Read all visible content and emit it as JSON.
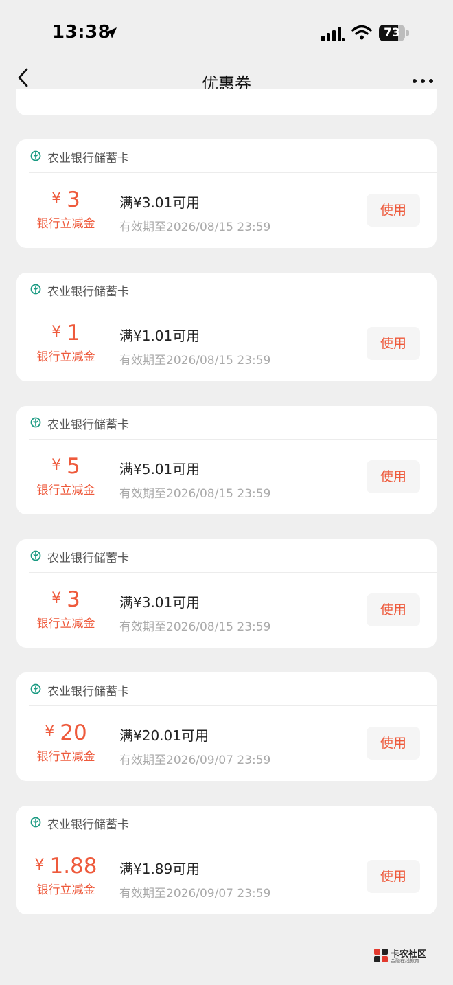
{
  "status_bar": {
    "time": "13:38",
    "battery": "73",
    "battery_level": 0.73,
    "icons": [
      "location-arrow-icon",
      "signal-icon",
      "wifi-icon",
      "battery-icon"
    ]
  },
  "nav": {
    "title": "优惠券",
    "back_icon": "chevron-left-icon",
    "more_icon": "more-horizontal-icon"
  },
  "coupons": [
    {
      "bank": "农业银行储蓄卡",
      "yen": "¥",
      "amount": "3",
      "label": "银行立减金",
      "condition": "满¥3.01可用",
      "validity": "有效期至2026/08/15 23:59",
      "button": "使用"
    },
    {
      "bank": "农业银行储蓄卡",
      "yen": "¥",
      "amount": "1",
      "label": "银行立减金",
      "condition": "满¥1.01可用",
      "validity": "有效期至2026/08/15 23:59",
      "button": "使用"
    },
    {
      "bank": "农业银行储蓄卡",
      "yen": "¥",
      "amount": "5",
      "label": "银行立减金",
      "condition": "满¥5.01可用",
      "validity": "有效期至2026/08/15 23:59",
      "button": "使用"
    },
    {
      "bank": "农业银行储蓄卡",
      "yen": "¥",
      "amount": "3",
      "label": "银行立减金",
      "condition": "满¥3.01可用",
      "validity": "有效期至2026/08/15 23:59",
      "button": "使用"
    },
    {
      "bank": "农业银行储蓄卡",
      "yen": "¥",
      "amount": "20",
      "label": "银行立减金",
      "condition": "满¥20.01可用",
      "validity": "有效期至2026/09/07 23:59",
      "button": "使用"
    },
    {
      "bank": "农业银行储蓄卡",
      "yen": "¥",
      "amount": "1.88",
      "label": "银行立减金",
      "condition": "满¥1.89可用",
      "validity": "有效期至2026/09/07 23:59",
      "button": "使用"
    }
  ],
  "watermark": {
    "text": "卡农社区",
    "subtext": "金融在线教育"
  },
  "colors": {
    "accent": "#ee5a3c",
    "bank_green": "#1a9a82",
    "background": "#efefef"
  }
}
